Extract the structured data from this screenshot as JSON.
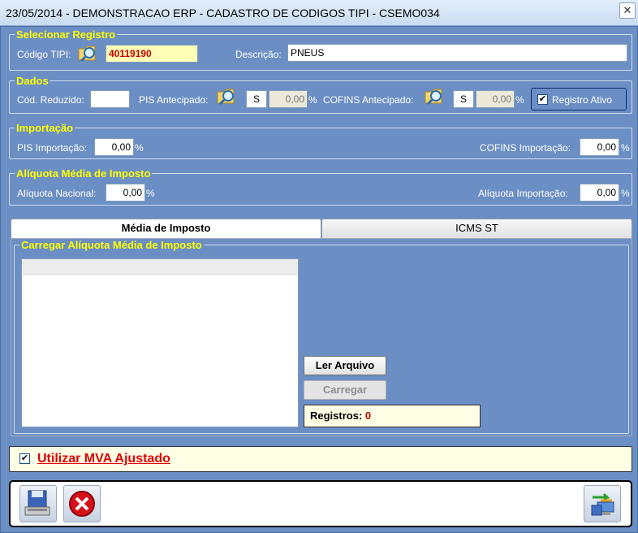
{
  "window": {
    "title": "23/05/2014  -  DEMONSTRACAO ERP  -  CADASTRO DE CODIGOS TIPI  -  CSEMO034",
    "close_glyph": "✕"
  },
  "selecionar": {
    "legend": "Selecionar Registro",
    "codigo_label": "Código TIPI:",
    "codigo_value": "40119190",
    "descricao_label": "Descrição:",
    "descricao_value": "PNEUS"
  },
  "dados": {
    "legend": "Dados",
    "cod_reduzido_label": "Cód. Reduzido:",
    "cod_reduzido_value": "",
    "pis_antecipado_label": "PIS Antecipado:",
    "pis_flag": "S",
    "pis_value": "0,00",
    "cofins_antecipado_label": "COFINS Antecipado:",
    "cofins_flag": "S",
    "cofins_value": "0,00",
    "percent": "%",
    "registro_ativo_label": "Registro Ativo",
    "registro_ativo_checked": true,
    "check_glyph": "✔"
  },
  "importacao": {
    "legend": "Importação",
    "pis_label": "PIS Importação:",
    "pis_value": "0,00",
    "cofins_label": "COFINS Importação:",
    "cofins_value": "0,00",
    "percent": "%"
  },
  "aliquota": {
    "legend": "Alíquota Média de Imposto",
    "nacional_label": "Alíquota Nacional:",
    "nacional_value": "0,00",
    "importacao_label": "Alíquota Importação:",
    "importacao_value": "0,00",
    "percent": "%"
  },
  "tabs": [
    {
      "label": "Média de Imposto",
      "active": true
    },
    {
      "label": "ICMS ST",
      "active": false
    }
  ],
  "carregar": {
    "legend": "Carregar Alíquota Média de Imposto",
    "ler_arquivo_label": "Ler Arquivo",
    "carregar_label": "Carregar",
    "registros_label": "Registros:",
    "registros_value": "0"
  },
  "mva": {
    "label": "Utilizar MVA Ajustado",
    "checked": true,
    "check_glyph": "✔"
  },
  "toolbar": {
    "save_icon": "save-disk-icon",
    "cancel_icon": "cancel-icon",
    "exchange_icon": "exchange-icon"
  },
  "colors": {
    "background": "#6b8fc4",
    "legend": "#ffff00",
    "highlight_red": "#e00000"
  }
}
